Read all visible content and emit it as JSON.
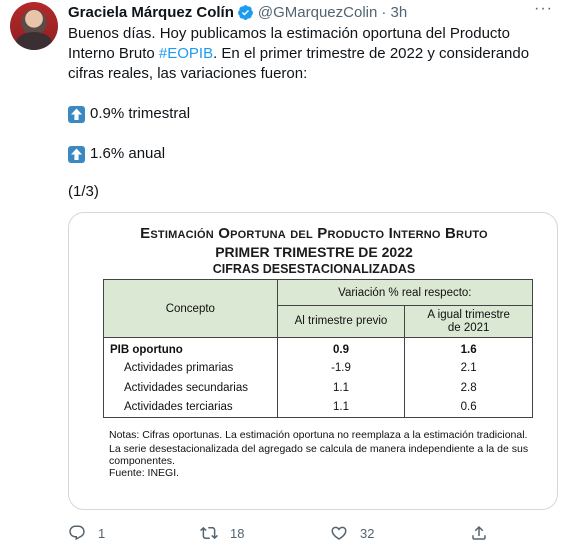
{
  "author": {
    "name": "Graciela Márquez Colín",
    "handle": "@GMarquezColin",
    "time": "· 3h",
    "verified": true
  },
  "more_label": "···",
  "tweet": {
    "text_before": "Buenos días. Hoy publicamos la estimación oportuna del Producto Interno Bruto ",
    "hashtag": "#EOPIB",
    "text_after": ". En el primer trimestre de 2022 y considerando cifras reales, las variaciones fueron:",
    "line1": "0.9% trimestral",
    "line2": "1.6% anual",
    "thread_marker": "(1/3)"
  },
  "card": {
    "title1": "Estimación Oportuna del Producto Interno Bruto",
    "title2": "PRIMER TRIMESTRE DE 2022",
    "title3": "CIFRAS DESESTACIONALIZADAS",
    "table": {
      "header_concepto": "Concepto",
      "header_variacion": "Variación % real respecto:",
      "header_col1": "Al trimestre previo",
      "header_col2_line1": "A igual trimestre",
      "header_col2_line2": "de 2021",
      "rows": [
        {
          "concepto": "PIB oportuno",
          "trimestre": "0.9",
          "anual": "1.6"
        },
        {
          "concepto": "Actividades primarias",
          "trimestre": "-1.9",
          "anual": "2.1"
        },
        {
          "concepto": "Actividades secundarias",
          "trimestre": "1.1",
          "anual": "2.8"
        },
        {
          "concepto": "Actividades terciarias",
          "trimestre": "1.1",
          "anual": "0.6"
        }
      ]
    },
    "notes": {
      "n1": "Notas: Cifras oportunas. La estimación oportuna no reemplaza a la estimación tradicional.",
      "n2": "La serie desestacionalizada del agregado se calcula de manera independiente a la de sus componentes.",
      "n3": "Fuente: INEGI."
    }
  },
  "actions": {
    "replies": "1",
    "retweets": "18",
    "likes": "32"
  },
  "colors": {
    "link": "#1d9bf0",
    "secondary_text": "#536471",
    "table_header_bg": "#dbe8d3",
    "emoji_up_bg": "#3b88c3"
  }
}
